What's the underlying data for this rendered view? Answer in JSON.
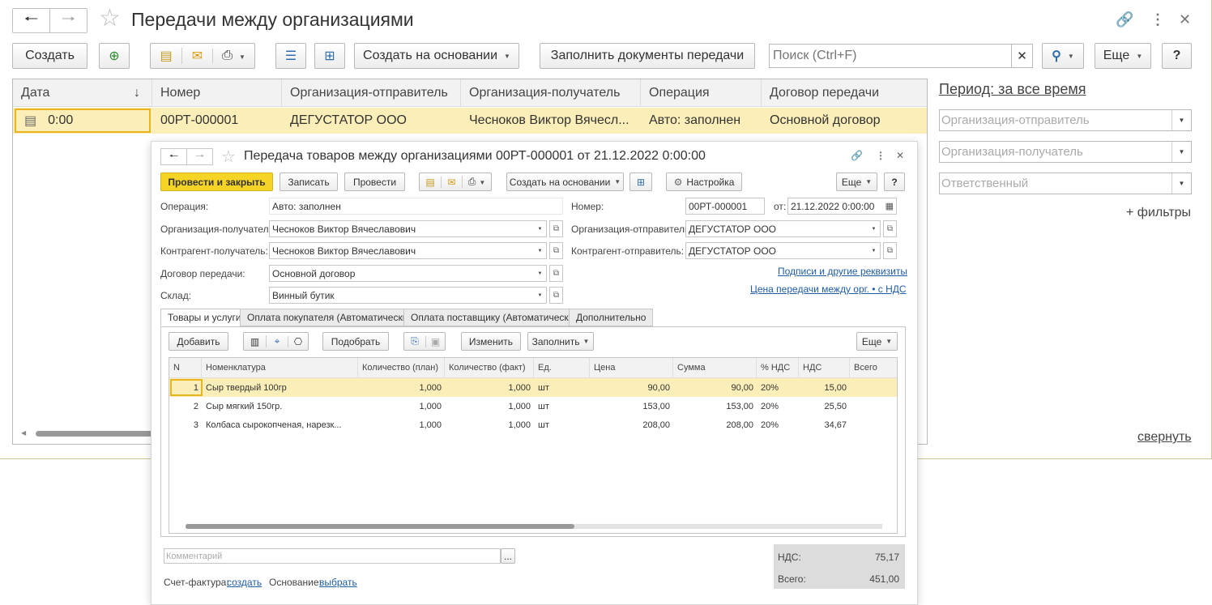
{
  "window": {
    "title": "Передачи между организациями"
  },
  "toolbar": {
    "create": "Создать",
    "create_based": "Создать на основании",
    "fill_docs": "Заполнить документы передачи",
    "search_placeholder": "Поиск (Ctrl+F)",
    "more": "Еще",
    "help": "?"
  },
  "list": {
    "columns": [
      "Дата",
      "Номер",
      "Организация-отправитель",
      "Организация-получатель",
      "Операция",
      "Договор передачи"
    ],
    "row": {
      "date": "0:00",
      "number": "00РТ-000001",
      "sender": "ДЕГУСТАТОР ООО",
      "receiver": "Чесноков Виктор Вячесл...",
      "operation": "Авто: заполнен",
      "contract": "Основной договор"
    }
  },
  "side": {
    "period": "Период: за все время",
    "f_sender": "Организация-отправитель",
    "f_receiver": "Организация-получатель",
    "f_resp": "Ответственный",
    "add_filters": "+ фильтры",
    "collapse": "свернуть"
  },
  "doc": {
    "title": "Передача товаров между организациями 00РТ-000001 от 21.12.2022 0:00:00",
    "btn_post_close": "Провести и закрыть",
    "btn_save": "Записать",
    "btn_post": "Провести",
    "btn_create_based": "Создать на основании",
    "btn_settings": "Настройка",
    "btn_more": "Еще",
    "btn_help": "?",
    "l_operation": "Операция:",
    "v_operation": "Авто: заполнен",
    "l_number": "Номер:",
    "v_number": "00РТ-000001",
    "l_from": "от:",
    "v_date": "21.12.2022  0:00:00",
    "l_org_recv": "Организация-получатель:",
    "v_org_recv": "Чесноков Виктор Вячеславович",
    "l_org_send": "Организация-отправитель:",
    "v_org_send": "ДЕГУСТАТОР ООО",
    "l_cp_recv": "Контрагент-получатель:",
    "v_cp_recv": "Чесноков Виктор Вячеславович",
    "l_cp_send": "Контрагент-отправитель:",
    "v_cp_send": "ДЕГУСТАТОР ООО",
    "l_contract": "Договор передачи:",
    "v_contract": "Основной договор",
    "l_warehouse": "Склад:",
    "v_warehouse": "Винный бутик",
    "link_signs": "Подписи и другие реквизиты",
    "link_price": "Цена передачи между орг. • с НДС",
    "tabs": [
      "Товары и услуги",
      "Оплата покупателя (Автоматически)",
      "Оплата поставщику (Автоматически)",
      "Дополнительно"
    ],
    "t_add": "Добавить",
    "t_pick": "Подобрать",
    "t_change": "Изменить",
    "t_fill": "Заполнить",
    "t_more": "Еще",
    "cols": [
      "N",
      "Номенклатура",
      "Количество (план)",
      "Количество (факт)",
      "Ед.",
      "Цена",
      "Сумма",
      "% НДС",
      "НДС",
      "Всего"
    ],
    "rows": [
      [
        "1",
        "Сыр твердый 100гр",
        "1,000",
        "1,000",
        "шт",
        "90,00",
        "90,00",
        "20%",
        "15,00"
      ],
      [
        "2",
        "Сыр мягкий 150гр.",
        "1,000",
        "1,000",
        "шт",
        "153,00",
        "153,00",
        "20%",
        "25,50"
      ],
      [
        "3",
        "Колбаса сырокопченая, нарезк...",
        "1,000",
        "1,000",
        "шт",
        "208,00",
        "208,00",
        "20%",
        "34,67"
      ]
    ],
    "comment_placeholder": "Комментарий",
    "comment_btn": "...",
    "l_vat": "НДС:",
    "v_vat": "75,17",
    "l_total": "Всего:",
    "v_total": "451,00",
    "l_invoice": "Счет-фактура:",
    "link_invoice": "создать",
    "l_basis": "Основание:",
    "link_basis": "выбрать"
  }
}
